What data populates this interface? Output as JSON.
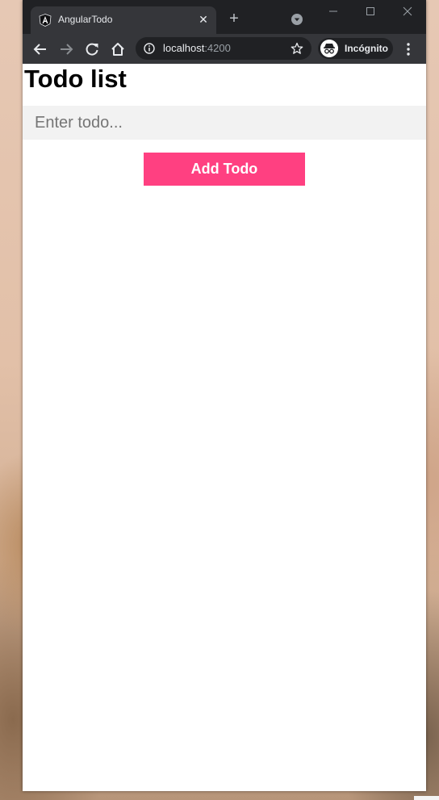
{
  "browser": {
    "tab": {
      "title": "AngularTodo",
      "favicon": "angular-logo-icon",
      "close_icon": "close-icon"
    },
    "new_tab_icon": "plus-icon",
    "tab_search_icon": "chevron-down-circle-icon",
    "window_controls": [
      "minimize-icon",
      "maximize-icon",
      "close-icon"
    ],
    "toolbar": {
      "back_icon": "arrow-left-icon",
      "forward_icon": "arrow-right-icon",
      "reload_icon": "reload-icon",
      "home_icon": "home-icon",
      "site_info_icon": "info-icon",
      "url_host": "localhost",
      "url_port": ":4200",
      "bookmark_icon": "star-icon",
      "profile_label": "Incógnito",
      "profile_icon": "incognito-icon",
      "menu_icon": "more-vertical-icon"
    },
    "colors": {
      "tabstrip": "#202124",
      "toolbar": "#35363a"
    }
  },
  "app": {
    "title": "Todo list",
    "input": {
      "placeholder": "Enter todo...",
      "value": ""
    },
    "add_button_label": "Add Todo",
    "colors": {
      "accent": "#ff4081",
      "input_background": "#f2f2f2"
    }
  }
}
